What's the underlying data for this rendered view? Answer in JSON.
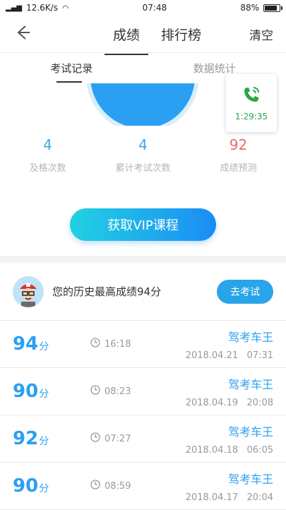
{
  "status": {
    "network_left": "12.6K/s",
    "time": "07:48",
    "battery": "88%",
    "battery_fraction": 0.88
  },
  "header": {
    "tabs": [
      "成绩",
      "排行榜"
    ],
    "clear": "清空"
  },
  "subtabs": [
    "考试记录",
    "数据统计"
  ],
  "call": {
    "time": "1:29:35"
  },
  "stats": [
    {
      "value": "4",
      "label": "及格次数"
    },
    {
      "value": "4",
      "label": "累计考试次数"
    },
    {
      "value": "92",
      "label": "成绩预测"
    }
  ],
  "vip": {
    "label": "获取VIP课程"
  },
  "best": {
    "text": "您的历史最高成绩94分",
    "button": "去考试"
  },
  "records": [
    {
      "score": "94",
      "unit": "分",
      "duration": "16:18",
      "name": "驾考车王",
      "date": "2018.04.21",
      "time": "07:31"
    },
    {
      "score": "90",
      "unit": "分",
      "duration": "08:23",
      "name": "驾考车王",
      "date": "2018.04.19",
      "time": "20:08"
    },
    {
      "score": "92",
      "unit": "分",
      "duration": "07:27",
      "name": "驾考车王",
      "date": "2018.04.18",
      "time": "06:05"
    },
    {
      "score": "90",
      "unit": "分",
      "duration": "08:59",
      "name": "驾考车王",
      "date": "2018.04.17",
      "time": "20:04"
    }
  ],
  "icons": {
    "back": "back-arrow-icon",
    "phone": "phone-icon",
    "clock": "clock-icon"
  },
  "colors": {
    "accent": "#2b9ff2",
    "prediction": "#e86a6a",
    "call_green": "#29a745"
  }
}
